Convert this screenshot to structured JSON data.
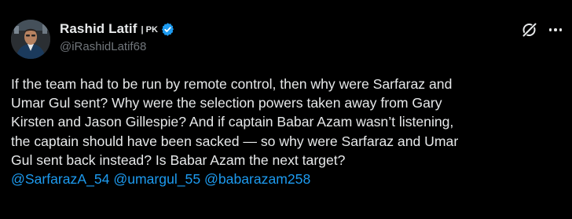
{
  "author": {
    "display_name": "Rashid Latif",
    "flag_label": "| PK",
    "handle": "@iRashidLatif68",
    "verified": true,
    "verified_color": "#1d9bf0",
    "avatar_icon": "avatar"
  },
  "actions": {
    "grok_icon": "grok-icon",
    "more_icon": "more-options-icon"
  },
  "tweet": {
    "lines": [
      "If the team had to be run by remote control, then why were Sarfaraz and",
      "Umar Gul sent? Why were the selection powers taken away from Gary",
      "Kirsten and Jason Gillespie? And if captain Babar Azam wasn’t listening,",
      "the captain should have been sacked — so why were Sarfaraz and Umar",
      "Gul sent back instead? Is Babar Azam the next target?"
    ],
    "mentions": [
      "@SarfarazA_54",
      "@umargul_55",
      "@babarazam258"
    ]
  },
  "colors": {
    "background": "#000000",
    "text": "#e7e9ea",
    "secondary_text": "#71767b",
    "link": "#1d9bf0"
  }
}
